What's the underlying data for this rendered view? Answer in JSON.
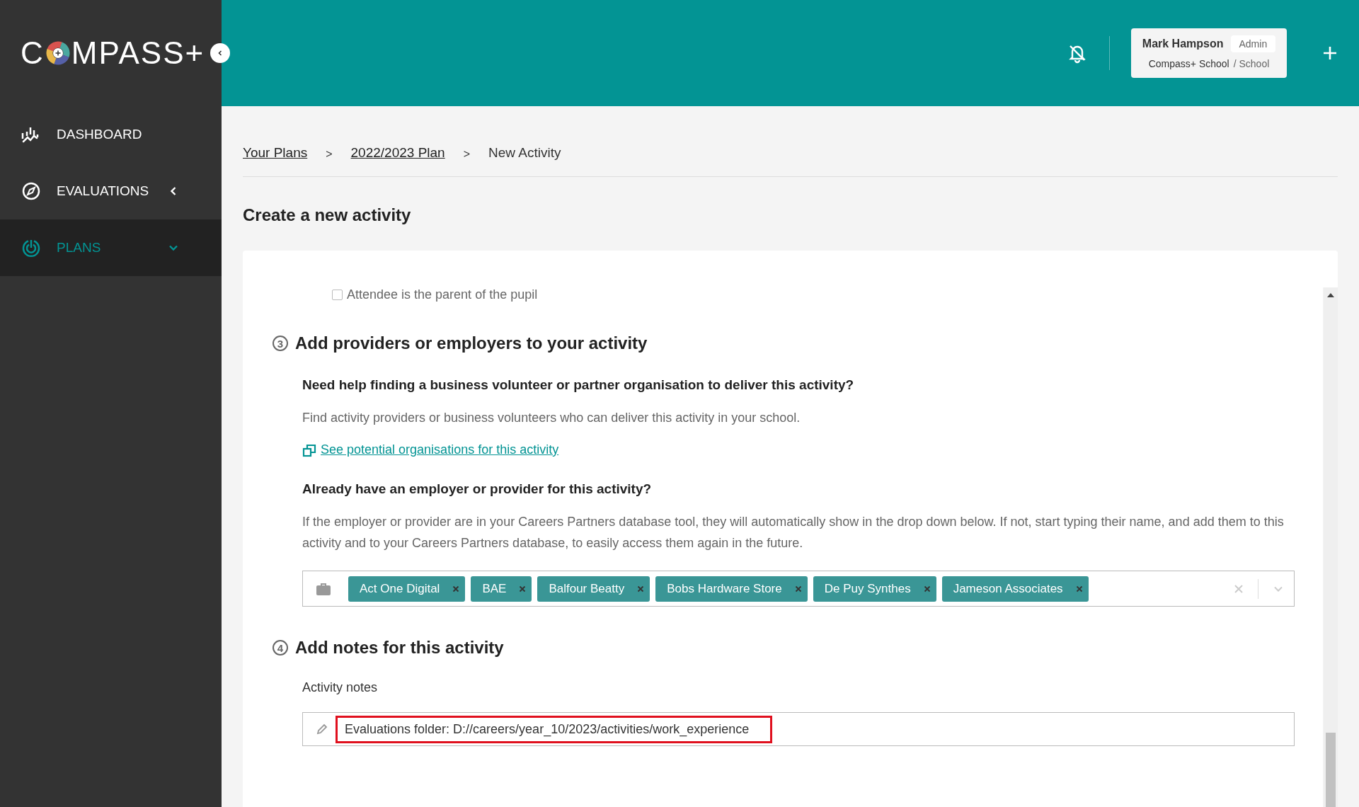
{
  "logo": {
    "left": "C",
    "right": "MPASS+"
  },
  "sidebar": {
    "items": [
      {
        "label": "DASHBOARD",
        "kind": "dashboard",
        "selected": false
      },
      {
        "label": "EVALUATIONS",
        "kind": "evaluations",
        "selected": false,
        "expanded": false
      },
      {
        "label": "PLANS",
        "kind": "plans",
        "selected": true,
        "expanded": true
      }
    ]
  },
  "header": {
    "user": {
      "name": "Mark Hampson",
      "role": "Admin",
      "organisation": "Compass+ School",
      "type": "/ School"
    }
  },
  "breadcrumbs": [
    {
      "label": "Your Plans",
      "link": true
    },
    {
      "label": "2022/2023 Plan",
      "link": true
    },
    {
      "label": "New Activity",
      "link": false
    }
  ],
  "breadcrumb_separator": ">",
  "page_title": "Create a new activity",
  "form": {
    "parent_checkbox": {
      "label": "Attendee is the parent of the pupil",
      "checked": false
    },
    "sections": [
      {
        "number": "3",
        "title": "Add providers or employers to your activity"
      },
      {
        "number": "4",
        "title": "Add notes for this activity"
      }
    ],
    "help_question": "Need help finding a business volunteer or partner organisation to deliver this activity?",
    "help_text": "Find activity providers or business volunteers who can deliver this activity in your school.",
    "help_link": "See potential organisations for this activity",
    "existing_question": "Already have an employer or provider for this activity?",
    "existing_text": "If the employer or provider are in your Careers Partners database tool, they will automatically show in the drop down below. If not, start typing their name, and add them to this activity and to your Careers Partners database, to easily access them again in the future.",
    "providers": [
      {
        "label": "Act One Digital"
      },
      {
        "label": "BAE"
      },
      {
        "label": "Balfour Beatty"
      },
      {
        "label": "Bobs Hardware Store"
      },
      {
        "label": "De Puy Synthes"
      },
      {
        "label": "Jameson Associates"
      }
    ],
    "notes_label": "Activity notes",
    "notes_value": "Evaluations folder: D://careers/year_10/2023/activities/work_experience",
    "notes_highlighted": true
  }
}
